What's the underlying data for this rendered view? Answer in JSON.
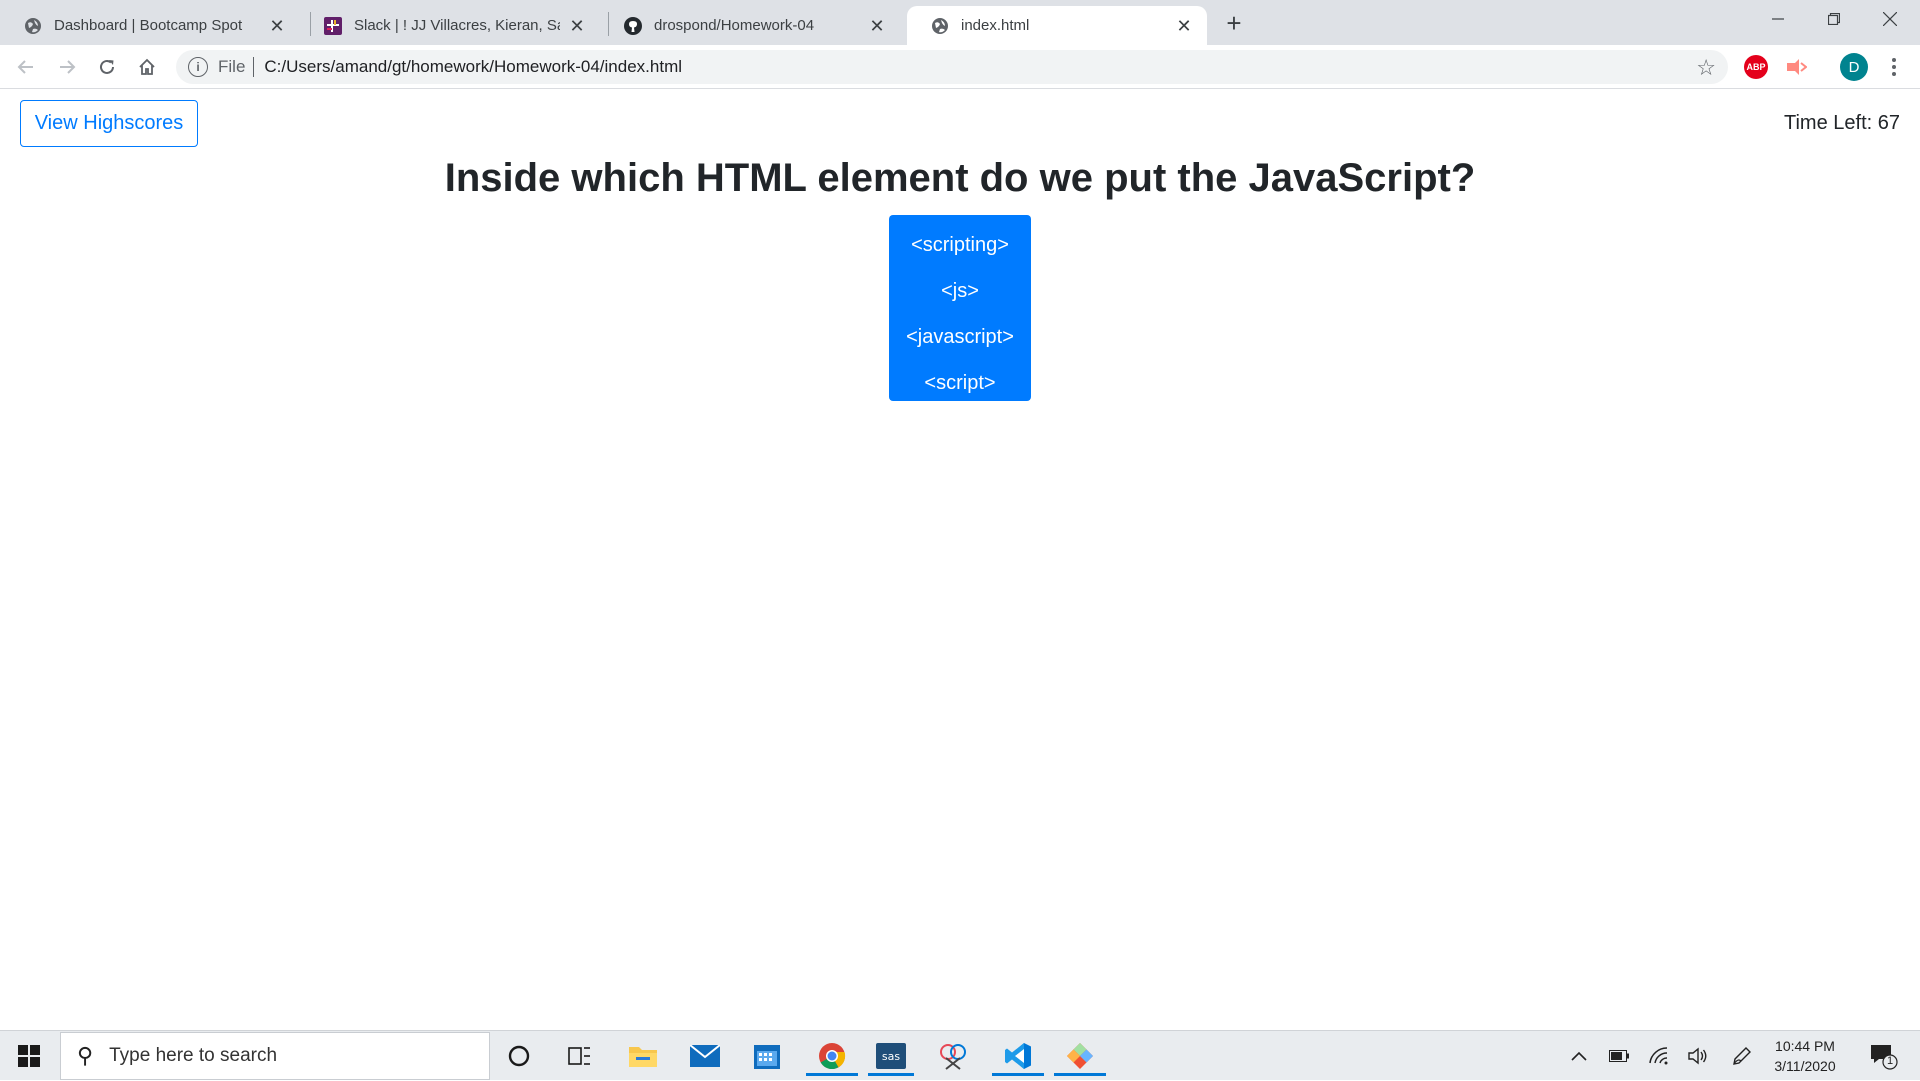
{
  "browser": {
    "tabs": [
      {
        "title": "Dashboard | Bootcamp Spot",
        "icon": "globe-icon",
        "active": false
      },
      {
        "title": "Slack | ! JJ Villacres, Kieran, Sam S",
        "icon": "slack-icon",
        "active": false
      },
      {
        "title": "drospond/Homework-04",
        "icon": "github-icon",
        "active": false
      },
      {
        "title": "index.html",
        "icon": "globe-icon",
        "active": true
      }
    ],
    "new_tab_label": "+",
    "omnibox": {
      "scheme_label": "File",
      "url": "C:/Users/amand/gt/homework/Homework-04/index.html"
    },
    "profile_initial": "D",
    "extensions": [
      {
        "name": "adblock-plus-icon",
        "label": "ABP",
        "color": "#e4001b"
      },
      {
        "name": "screencast-icon",
        "label": "",
        "color": "#ff6b6b"
      }
    ]
  },
  "page": {
    "highscores_label": "View Highscores",
    "timer_text": "Time Left: 67",
    "question": "Inside which HTML element do we put the JavaScript?",
    "answers": [
      "<scripting>",
      "<js>",
      "<javascript>",
      "<script>"
    ],
    "accent_color": "#007bff"
  },
  "taskbar": {
    "search_placeholder": "Type here to search",
    "apps": [
      "cortana-icon",
      "task-view-icon",
      "file-explorer-icon",
      "mail-icon",
      "calendar-icon",
      "chrome-icon",
      "sas-icon",
      "snip-icon",
      "vscode-icon",
      "git-icon"
    ],
    "sas_label": "sas",
    "time": "10:44 PM",
    "date": "3/11/2020",
    "notification_count": "1"
  }
}
